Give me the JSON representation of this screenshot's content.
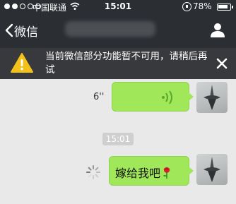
{
  "status_bar": {
    "carrier": "中国联通",
    "time": "15:01",
    "battery": "78%",
    "signal_filled": 2,
    "signal_total": 5
  },
  "nav": {
    "back_label": "微信"
  },
  "warning": {
    "text": "当前微信部分功能暂不可用，请稍后再试"
  },
  "chat": {
    "messages": [
      {
        "type": "voice",
        "duration": "6''"
      },
      {
        "type": "timestamp",
        "text": "15:01"
      },
      {
        "type": "text",
        "text": "嫁给我吧",
        "emoji": "rose-icon",
        "status": "sending"
      }
    ]
  },
  "colors": {
    "nav_background": "#2b2e33",
    "banner_background": "#38393c",
    "warning_yellow": "#f2c21b",
    "bubble_green": "#a0e75a",
    "chat_background": "#e9e9e9"
  },
  "icons": [
    "back-chevron-icon",
    "profile-icon",
    "warning-icon",
    "close-icon",
    "voice-wave-icon",
    "rose-icon",
    "sending-spinner-icon",
    "wifi-icon",
    "rotation-lock-icon",
    "battery-icon"
  ]
}
